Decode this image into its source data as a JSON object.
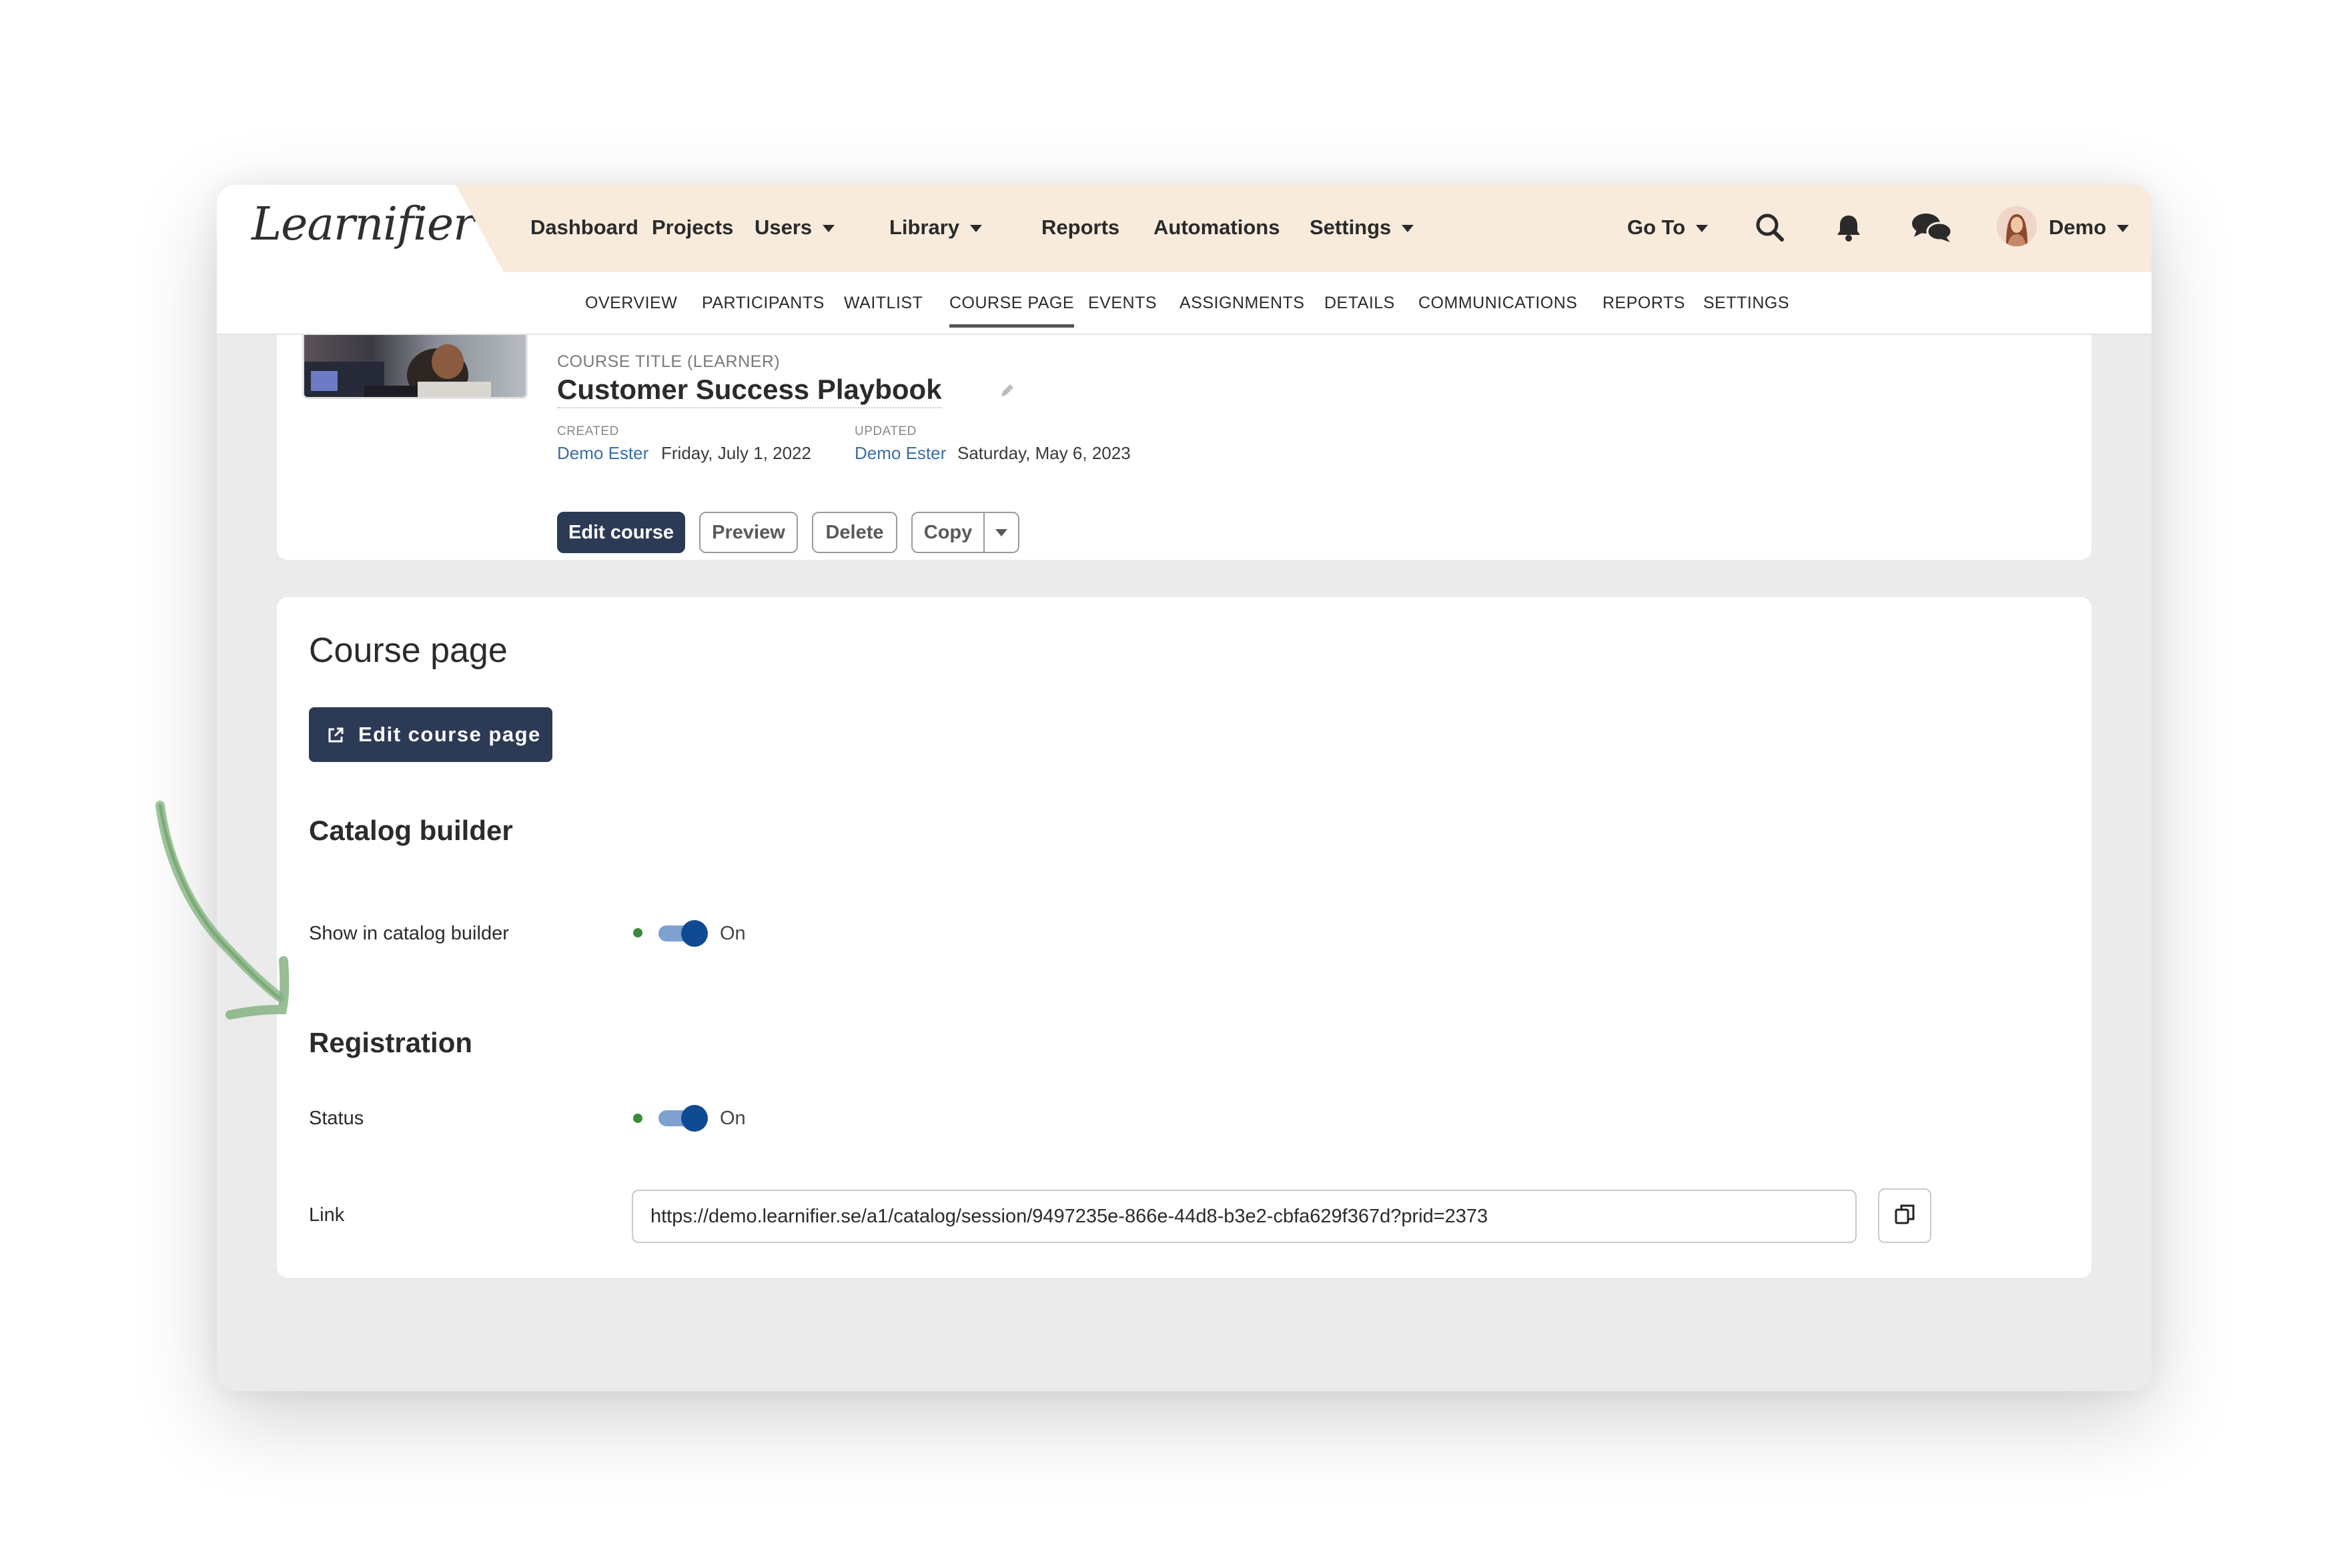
{
  "app": {
    "logo_text": "Learnifier"
  },
  "topnav": {
    "items": [
      {
        "label": "Dashboard",
        "dropdown": false
      },
      {
        "label": "Projects",
        "dropdown": false
      },
      {
        "label": "Users",
        "dropdown": true
      },
      {
        "label": "Library",
        "dropdown": true
      },
      {
        "label": "Reports",
        "dropdown": false
      },
      {
        "label": "Automations",
        "dropdown": false
      },
      {
        "label": "Settings",
        "dropdown": true
      }
    ],
    "goto_label": "Go To",
    "user_name": "Demo",
    "icons": [
      "search-icon",
      "bell-icon",
      "chat-icon",
      "avatar"
    ]
  },
  "subnav": {
    "tabs": [
      "OVERVIEW",
      "PARTICIPANTS",
      "WAITLIST",
      "COURSE PAGE",
      "EVENTS",
      "ASSIGNMENTS",
      "DETAILS",
      "COMMUNICATIONS",
      "REPORTS",
      "SETTINGS"
    ],
    "active_tab": "COURSE PAGE"
  },
  "course": {
    "title_label": "COURSE TITLE (LEARNER)",
    "title": "Customer Success Playbook",
    "created_label": "CREATED",
    "created_by": "Demo Ester",
    "created_date": "Friday, July 1, 2022",
    "updated_label": "UPDATED",
    "updated_by": "Demo Ester",
    "updated_date": "Saturday, May 6, 2023",
    "buttons": {
      "edit": "Edit course",
      "preview": "Preview",
      "delete": "Delete",
      "copy": "Copy"
    }
  },
  "course_page": {
    "heading": "Course page",
    "edit_button": "Edit course page",
    "catalog_heading": "Catalog builder",
    "catalog_toggle_label": "Show in catalog builder",
    "catalog_toggle_state": "On",
    "registration_heading": "Registration",
    "status_label": "Status",
    "status_toggle_state": "On",
    "link_label": "Link",
    "link_value": "https://demo.learnifier.se/a1/catalog/session/9497235e-866e-44d8-b3e2-cbfa629f367d?prid=2373"
  },
  "colors": {
    "topbar_bg": "#f8ebdc",
    "primary_button": "#2c3a56",
    "link_blue": "#3a6ea5",
    "toggle_on": "#104a92",
    "status_dot": "#3c8a3c",
    "annotation_arrow": "#7fae7a"
  }
}
